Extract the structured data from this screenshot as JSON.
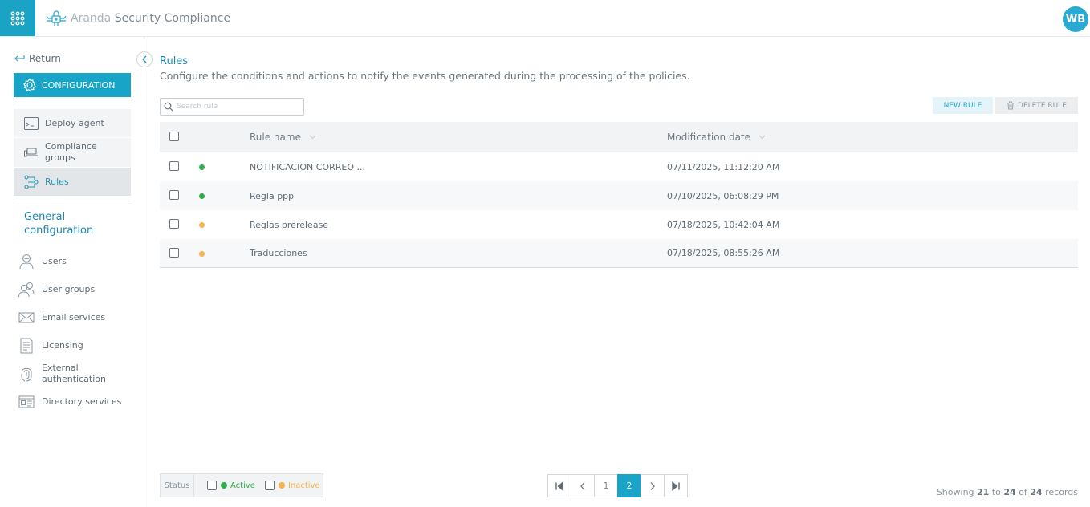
{
  "app": {
    "brand_prefix": "Aranda",
    "brand_name": "Security Compliance",
    "user_initials": "WB"
  },
  "sidebar": {
    "return_label": "Return",
    "config_label": "CONFIGURATION",
    "items": [
      {
        "label": "Deploy agent",
        "icon": "terminal-icon"
      },
      {
        "label": "Compliance groups",
        "icon": "devices-icon"
      },
      {
        "label": "Rules",
        "icon": "rules-icon",
        "active": true
      }
    ],
    "general_title": "General configuration",
    "general_items": [
      {
        "label": "Users",
        "icon": "user-icon"
      },
      {
        "label": "User groups",
        "icon": "user-group-icon"
      },
      {
        "label": "Email services",
        "icon": "envelope-icon"
      },
      {
        "label": "Licensing",
        "icon": "license-icon"
      },
      {
        "label": "External authentication",
        "icon": "fingerprint-icon"
      },
      {
        "label": "Directory services",
        "icon": "directory-icon"
      }
    ]
  },
  "main": {
    "title": "Rules",
    "description": "Configure the conditions and actions to notify the events generated during the processing of the policies.",
    "search_placeholder": "Search rule",
    "new_rule_label": "NEW RULE",
    "delete_rule_label": "DELETE RULE",
    "columns": {
      "name": "Rule name",
      "date": "Modification date"
    },
    "rows": [
      {
        "name": "NOTIFICACION CORREO ...",
        "date": "07/11/2025, 11:12:20 AM",
        "status": "active"
      },
      {
        "name": "Regla ppp",
        "date": "07/10/2025, 06:08:29 PM",
        "status": "active"
      },
      {
        "name": "Reglas prerelease",
        "date": "07/18/2025, 10:42:04 AM",
        "status": "inactive"
      },
      {
        "name": "Traducciones",
        "date": "07/18/2025, 08:55:26 AM",
        "status": "inactive"
      }
    ]
  },
  "footer": {
    "status_label": "Status",
    "active_label": "Active",
    "inactive_label": "Inactive",
    "pages": [
      "1",
      "2"
    ],
    "current_page": "2",
    "records": {
      "prefix": "Showing",
      "from": "21",
      "to_word": "to",
      "to": "24",
      "of_word": "of",
      "total": "24",
      "suffix": "records"
    }
  },
  "colors": {
    "accent": "#1aa4c7",
    "active": "#2ead4b",
    "inactive": "#f5b24e"
  }
}
